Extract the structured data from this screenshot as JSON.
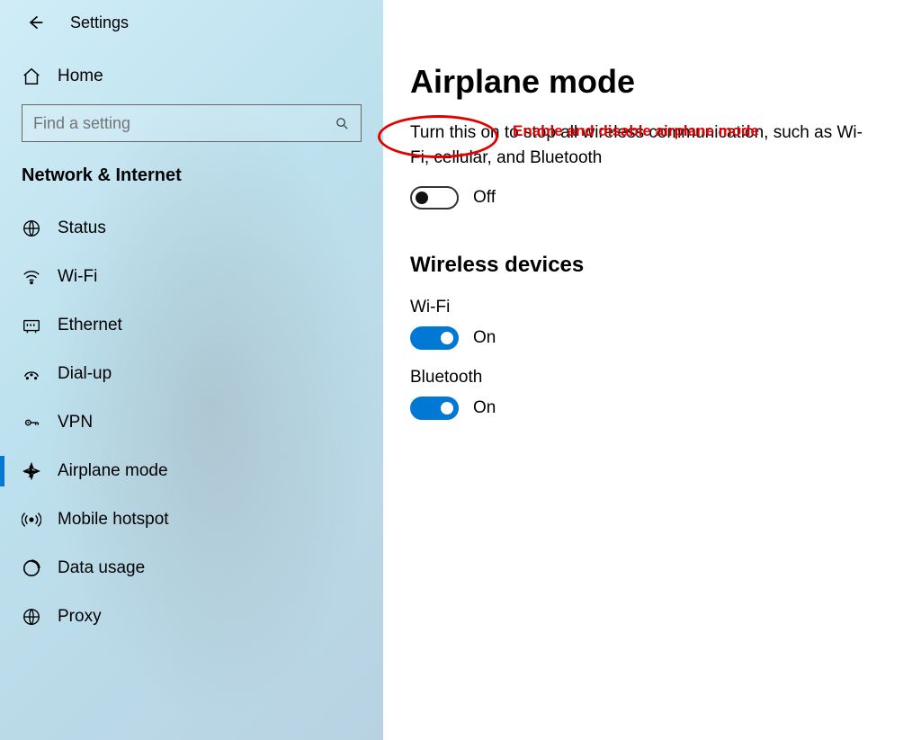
{
  "window": {
    "title": "Settings"
  },
  "sidebar": {
    "home_label": "Home",
    "search_placeholder": "Find a setting",
    "category_label": "Network & Internet",
    "items": [
      {
        "label": "Status",
        "icon": "globe",
        "selected": false
      },
      {
        "label": "Wi-Fi",
        "icon": "wifi",
        "selected": false
      },
      {
        "label": "Ethernet",
        "icon": "ethernet",
        "selected": false
      },
      {
        "label": "Dial-up",
        "icon": "dialup",
        "selected": false
      },
      {
        "label": "VPN",
        "icon": "vpn",
        "selected": false
      },
      {
        "label": "Airplane mode",
        "icon": "airplane",
        "selected": true
      },
      {
        "label": "Mobile hotspot",
        "icon": "hotspot",
        "selected": false
      },
      {
        "label": "Data usage",
        "icon": "datausage",
        "selected": false
      },
      {
        "label": "Proxy",
        "icon": "proxy",
        "selected": false
      }
    ]
  },
  "main": {
    "title": "Airplane mode",
    "description": "Turn this on to stop all wireless communication, such as Wi-Fi, cellular, and Bluetooth",
    "airplane_toggle": {
      "state": "off",
      "label": "Off"
    },
    "wireless_section_title": "Wireless devices",
    "devices": [
      {
        "name": "Wi-Fi",
        "state": "on",
        "label": "On"
      },
      {
        "name": "Bluetooth",
        "state": "on",
        "label": "On"
      }
    ]
  },
  "annotation": {
    "text": "Enable and disable airplane mode"
  }
}
